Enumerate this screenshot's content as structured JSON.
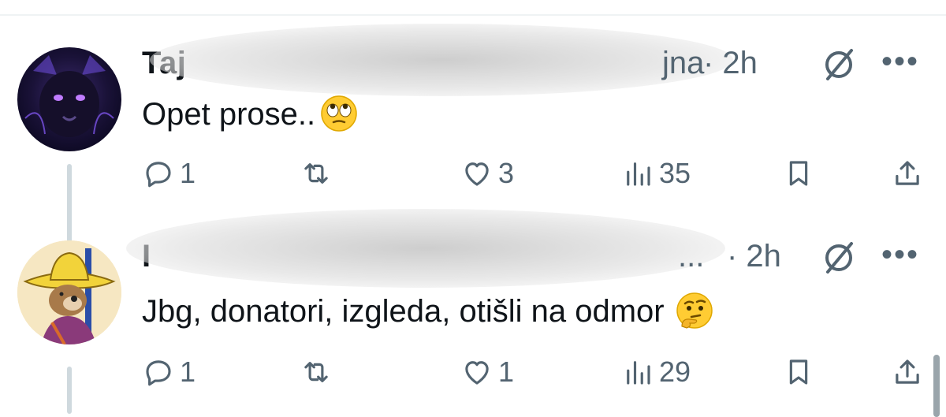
{
  "tweets": [
    {
      "name": "Taj",
      "handle_tail": "jna",
      "time": "· 2h",
      "text": "Opet prose..",
      "emoji": "face-with-rolling-eyes",
      "replies": "1",
      "likes": "3",
      "views": "35"
    },
    {
      "name": "I",
      "handle_tail": "...",
      "time": "· 2h",
      "text": "Jbg, donatori, izgleda, otišli na odmor",
      "emoji": "thinking-face",
      "replies": "1",
      "likes": "1",
      "views": "29"
    }
  ],
  "colors": {
    "muted": "#536471",
    "text": "#0f1419",
    "thread": "#cfd9de"
  }
}
